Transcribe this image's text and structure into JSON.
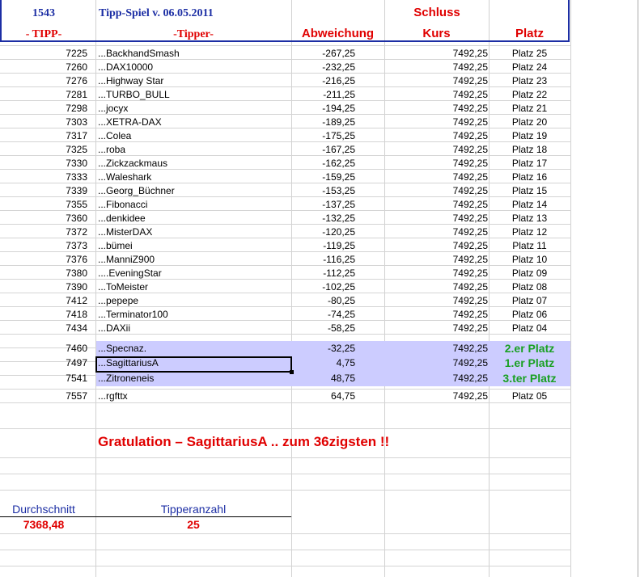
{
  "header": {
    "number": "1543",
    "title": "Tipp-Spiel v. 06.05.2011",
    "schluss": "Schluss",
    "col_tipp": "- TIPP-",
    "col_tipper": "-Tipper-",
    "col_abweichung": "Abweichung",
    "col_kurs": "Kurs",
    "col_platz": "Platz"
  },
  "rows": [
    {
      "tipp": "7225",
      "tipper": "...BackhandSmash",
      "abw": "-267,25",
      "kurs": "7492,25",
      "platz": "Platz 25"
    },
    {
      "tipp": "7260",
      "tipper": "...DAX10000",
      "abw": "-232,25",
      "kurs": "7492,25",
      "platz": "Platz 24"
    },
    {
      "tipp": "7276",
      "tipper": "...Highway Star",
      "abw": "-216,25",
      "kurs": "7492,25",
      "platz": "Platz 23"
    },
    {
      "tipp": "7281",
      "tipper": "...TURBO_BULL",
      "abw": "-211,25",
      "kurs": "7492,25",
      "platz": "Platz 22"
    },
    {
      "tipp": "7298",
      "tipper": "...jocyx",
      "abw": "-194,25",
      "kurs": "7492,25",
      "platz": "Platz 21"
    },
    {
      "tipp": "7303",
      "tipper": "...XETRA-DAX",
      "abw": "-189,25",
      "kurs": "7492,25",
      "platz": "Platz 20"
    },
    {
      "tipp": "7317",
      "tipper": "...Colea",
      "abw": "-175,25",
      "kurs": "7492,25",
      "platz": "Platz 19"
    },
    {
      "tipp": "7325",
      "tipper": "...roba",
      "abw": "-167,25",
      "kurs": "7492,25",
      "platz": "Platz 18"
    },
    {
      "tipp": "7330",
      "tipper": "...Zickzackmaus",
      "abw": "-162,25",
      "kurs": "7492,25",
      "platz": "Platz 17"
    },
    {
      "tipp": "7333",
      "tipper": "...Waleshark",
      "abw": "-159,25",
      "kurs": "7492,25",
      "platz": "Platz 16"
    },
    {
      "tipp": "7339",
      "tipper": "...Georg_Büchner",
      "abw": "-153,25",
      "kurs": "7492,25",
      "platz": "Platz 15"
    },
    {
      "tipp": "7355",
      "tipper": "...Fibonacci",
      "abw": "-137,25",
      "kurs": "7492,25",
      "platz": "Platz 14"
    },
    {
      "tipp": "7360",
      "tipper": "...denkidee",
      "abw": "-132,25",
      "kurs": "7492,25",
      "platz": "Platz 13"
    },
    {
      "tipp": "7372",
      "tipper": "...MisterDAX",
      "abw": "-120,25",
      "kurs": "7492,25",
      "platz": "Platz 12"
    },
    {
      "tipp": "7373",
      "tipper": "...bümei",
      "abw": "-119,25",
      "kurs": "7492,25",
      "platz": "Platz 11"
    },
    {
      "tipp": "7376",
      "tipper": "...ManniZ900",
      "abw": "-116,25",
      "kurs": "7492,25",
      "platz": "Platz 10"
    },
    {
      "tipp": "7380",
      "tipper": "....EveningStar",
      "abw": "-112,25",
      "kurs": "7492,25",
      "platz": "Platz 09"
    },
    {
      "tipp": "7390",
      "tipper": "...ToMeister",
      "abw": "-102,25",
      "kurs": "7492,25",
      "platz": "Platz 08"
    },
    {
      "tipp": "7412",
      "tipper": "...pepepe",
      "abw": "-80,25",
      "kurs": "7492,25",
      "platz": "Platz 07"
    },
    {
      "tipp": "7418",
      "tipper": "...Terminator100",
      "abw": "-74,25",
      "kurs": "7492,25",
      "platz": "Platz 06"
    },
    {
      "tipp": "7434",
      "tipper": "...DAXii",
      "abw": "-58,25",
      "kurs": "7492,25",
      "platz": "Platz 04"
    },
    {
      "tipp": "7460",
      "tipper": "...Specnaz.",
      "abw": "-32,25",
      "kurs": "7492,25",
      "platz": "2.er Platz",
      "podium": true
    },
    {
      "tipp": "7497",
      "tipper": "...SagittariusA",
      "abw": "4,75",
      "kurs": "7492,25",
      "platz": "1.er Platz",
      "podium": true
    },
    {
      "tipp": "7541",
      "tipper": "...Zitroneneis",
      "abw": "48,75",
      "kurs": "7492,25",
      "platz": "3.ter Platz",
      "podium": true
    },
    {
      "tipp": "7557",
      "tipper": "...rgfttx",
      "abw": "64,75",
      "kurs": "7492,25",
      "platz": "Platz 05"
    }
  ],
  "gratulation": "Gratulation – SagittariusA .. zum 36zigsten  !!",
  "footer": {
    "durchschnitt_label": "Durchschnitt",
    "durchschnitt_value": "7368,48",
    "tipperanzahl_label": "Tipperanzahl",
    "tipperanzahl_value": "25"
  },
  "colors": {
    "header_blue": "#1c2ea4",
    "red": "#e00000",
    "podium_green": "#1aa023",
    "highlight": "#ccccff"
  }
}
